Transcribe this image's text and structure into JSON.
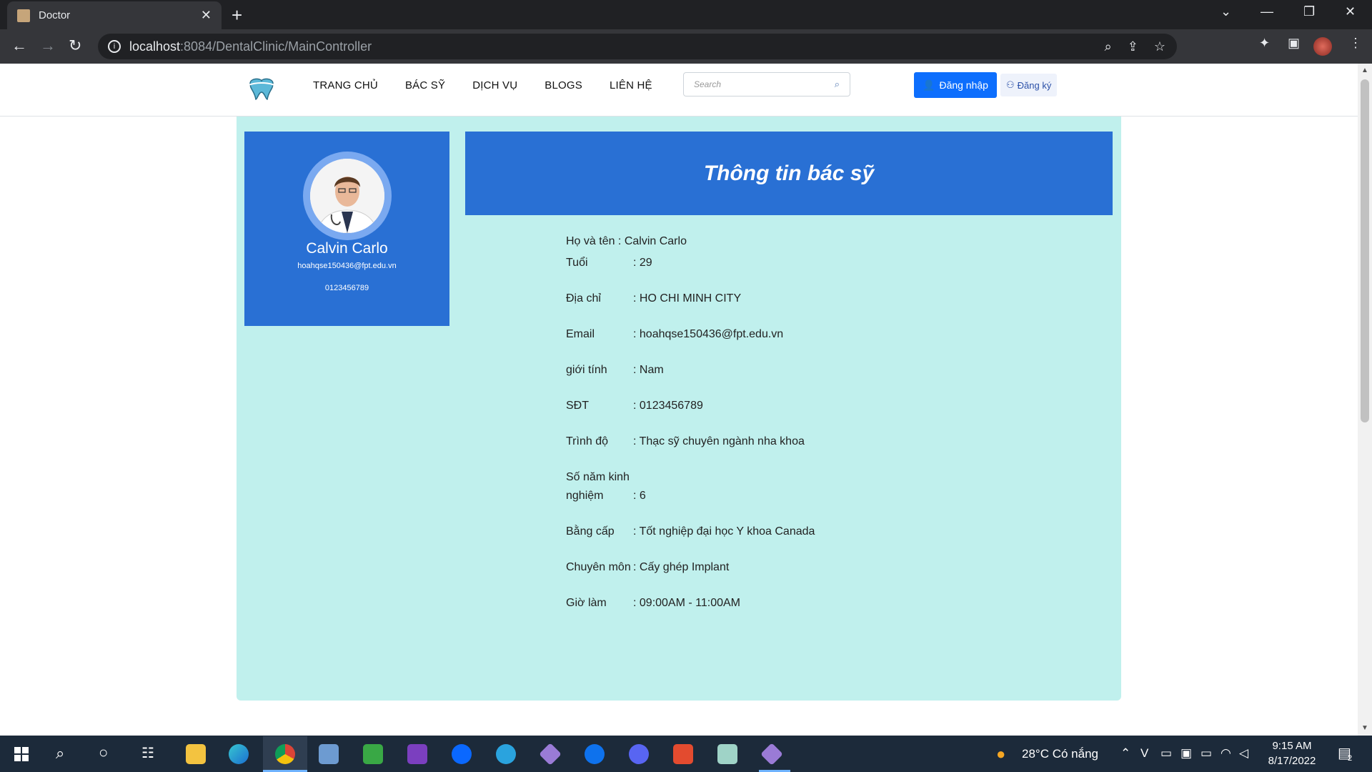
{
  "browser": {
    "tab_title": "Doctor",
    "url_host": "localhost",
    "url_path": ":8084/DentalClinic/MainController"
  },
  "nav": {
    "items": [
      "TRANG CHỦ",
      "BÁC SỸ",
      "DỊCH VỤ",
      "BLOGS",
      "LIÊN HỆ"
    ],
    "search_placeholder": "Search",
    "login_label": "Đăng nhập",
    "register_label": "Đăng ký"
  },
  "profile": {
    "name": "Calvin Carlo",
    "email": "hoahqse150436@fpt.edu.vn",
    "phone": "0123456789"
  },
  "info": {
    "banner_title": "Thông tin bác sỹ",
    "full_name_line": "Họ và tên : Calvin Carlo",
    "rows": [
      {
        "label": "Tuổi",
        "value": ": 29"
      },
      {
        "label": "Địa chỉ",
        "value": ": HO CHI MINH CITY"
      },
      {
        "label": "Email",
        "value": ": hoahqse150436@fpt.edu.vn"
      },
      {
        "label": "giới tính",
        "value": ": Nam"
      },
      {
        "label": "SĐT",
        "value": ": 0123456789"
      },
      {
        "label": "Trình độ",
        "value": ": Thạc sỹ chuyên ngành nha khoa"
      },
      {
        "label": "Số năm kinh nghiệm",
        "value": ": 6"
      },
      {
        "label": "Bằng cấp",
        "value": ": Tốt nghiệp đại học Y khoa Canada"
      },
      {
        "label": "Chuyên môn",
        "value": ": Cấy ghép Implant"
      },
      {
        "label": "Giờ làm",
        "value": ": 09:00AM - 11:00AM"
      }
    ]
  },
  "taskbar": {
    "weather": "28°C  Có nắng",
    "time": "9:15 AM",
    "date": "8/17/2022",
    "notification_count": "2"
  }
}
